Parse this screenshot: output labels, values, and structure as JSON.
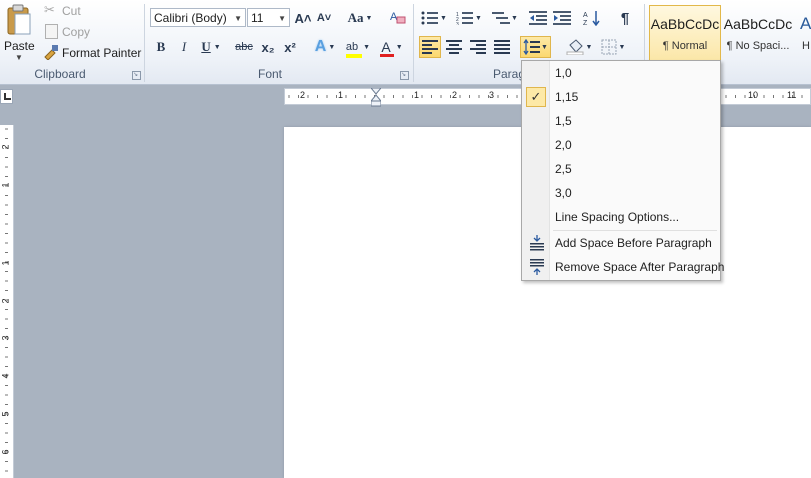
{
  "clipboard": {
    "paste_label": "Paste",
    "cut_label": "Cut",
    "copy_label": "Copy",
    "format_painter_label": "Format Painter",
    "group_label": "Clipboard"
  },
  "font": {
    "font_name": "Calibri (Body)",
    "font_size": "11",
    "group_label": "Font",
    "grow_glyph": "A˄",
    "shrink_glyph": "A˅",
    "change_case_glyph": "Aa",
    "bold_glyph": "B",
    "italic_glyph": "I",
    "underline_glyph": "U",
    "strike_glyph": "abc",
    "subscript_glyph": "x₂",
    "superscript_glyph": "x²",
    "highlight_color": "#ffff00",
    "font_color": "#e02020"
  },
  "paragraph": {
    "group_label": "Paragra",
    "pilcrow": "¶"
  },
  "styles": [
    {
      "sample": "AaBbCcDc",
      "name": "¶ Normal"
    },
    {
      "sample": "AaBbCcDc",
      "name": "¶ No Spaci..."
    },
    {
      "sample": "A",
      "name": "H"
    }
  ],
  "ruler": {
    "h_numbers": [
      "2",
      "1",
      "1",
      "2",
      "3",
      "10",
      "11"
    ],
    "v_numbers": [
      "2",
      "1",
      "1",
      "2",
      "3",
      "4",
      "5",
      "6"
    ]
  },
  "line_spacing_menu": {
    "items": [
      "1,0",
      "1,15",
      "1,5",
      "2,0",
      "2,5",
      "3,0"
    ],
    "selected": "1,15",
    "check_glyph": "✓",
    "options_label": "Line Spacing Options...",
    "add_before_label": "Add Space Before Paragraph",
    "remove_after_label": "Remove Space After Paragraph"
  },
  "colors": {
    "accent_selected": "#fbe7a8",
    "ribbon_bg": "#eef2f8",
    "workspace_bg": "#a9b3c0"
  }
}
